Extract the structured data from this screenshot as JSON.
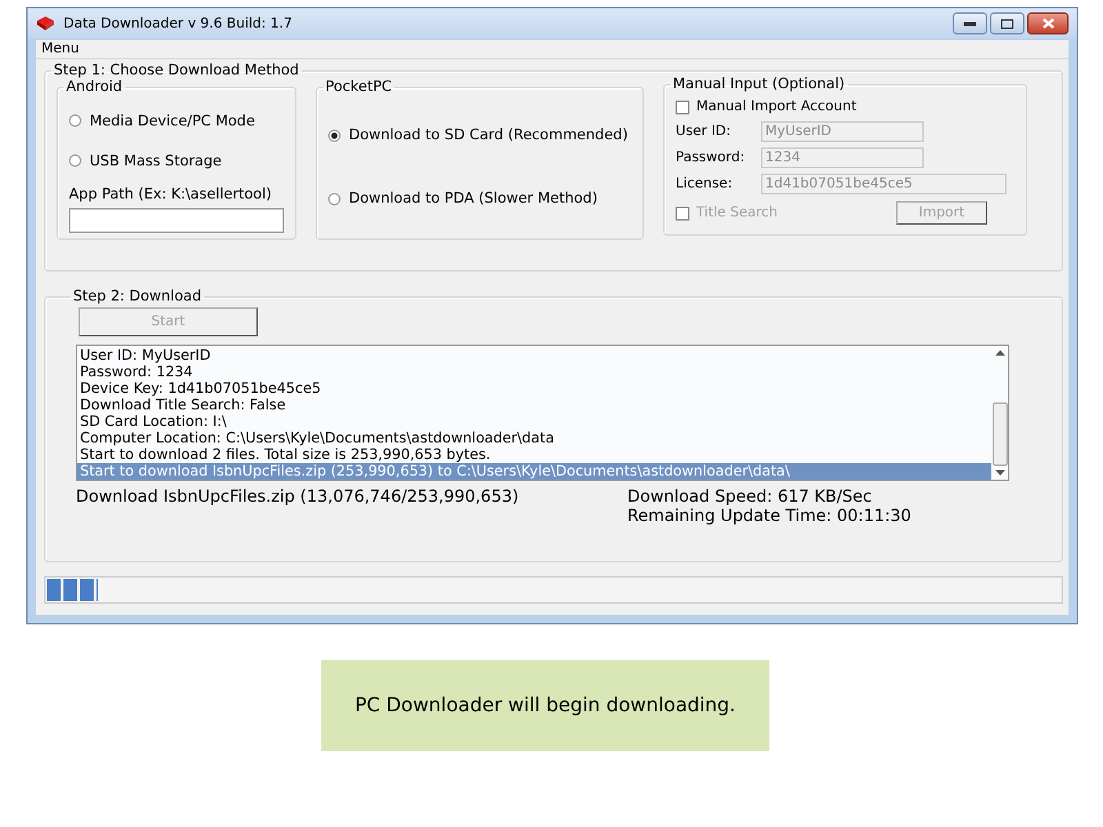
{
  "window": {
    "title": "Data Downloader v 9.6 Build: 1.7"
  },
  "menu": [
    "Menu"
  ],
  "step1": {
    "title": "Step 1: Choose Download Method",
    "android": {
      "title": "Android",
      "options": [
        {
          "label": "Media Device/PC Mode",
          "selected": false
        },
        {
          "label": "USB Mass Storage",
          "selected": false
        }
      ],
      "app_path_label": "App Path (Ex: K:\\asellertool)"
    },
    "pocketpc": {
      "title": "PocketPC",
      "options": [
        {
          "label": "Download to SD Card (Recommended)",
          "selected": true
        },
        {
          "label": "Download to PDA (Slower Method)",
          "selected": false
        }
      ]
    },
    "manual": {
      "title": "Manual Input (Optional)",
      "account": {
        "label": "Manual Import Account",
        "checked": false
      },
      "fields": [
        {
          "label": "User ID:",
          "value": "MyUserID",
          "disabled": true
        },
        {
          "label": "Password:",
          "value": "1234",
          "disabled": true
        },
        {
          "label": "License:",
          "value": "1d41b07051be45ce5",
          "disabled": true
        }
      ],
      "title_search": {
        "label": "Title Search",
        "checked": false,
        "disabled": true
      },
      "import": {
        "label": "Import",
        "disabled": true
      }
    }
  },
  "step2": {
    "title": "Step 2: Download",
    "start": {
      "label": "Start",
      "disabled": true
    },
    "log": [
      {
        "text": "User ID: MyUserID",
        "selected": false
      },
      {
        "text": "Password: 1234",
        "selected": false
      },
      {
        "text": "Device Key: 1d41b07051be45ce5",
        "selected": false
      },
      {
        "text": "Download Title Search: False",
        "selected": false
      },
      {
        "text": "SD Card Location: I:\\",
        "selected": false
      },
      {
        "text": "Computer Location: C:\\Users\\Kyle\\Documents\\astdownloader\\data",
        "selected": false
      },
      {
        "text": "Start to download 2 files. Total size is 253,990,653 bytes.",
        "selected": false
      },
      {
        "text": "Start to download IsbnUpcFiles.zip (253,990,653) to C:\\Users\\Kyle\\Documents\\astdownloader\\data\\",
        "selected": true
      }
    ],
    "status": "Download IsbnUpcFiles.zip (13,076,746/253,990,653)",
    "speed": "Download Speed: 617 KB/Sec",
    "remaining": "Remaining Update Time: 00:11:30"
  },
  "progress": {
    "level": 0.05
  },
  "caption": "PC Downloader will begin downloading."
}
